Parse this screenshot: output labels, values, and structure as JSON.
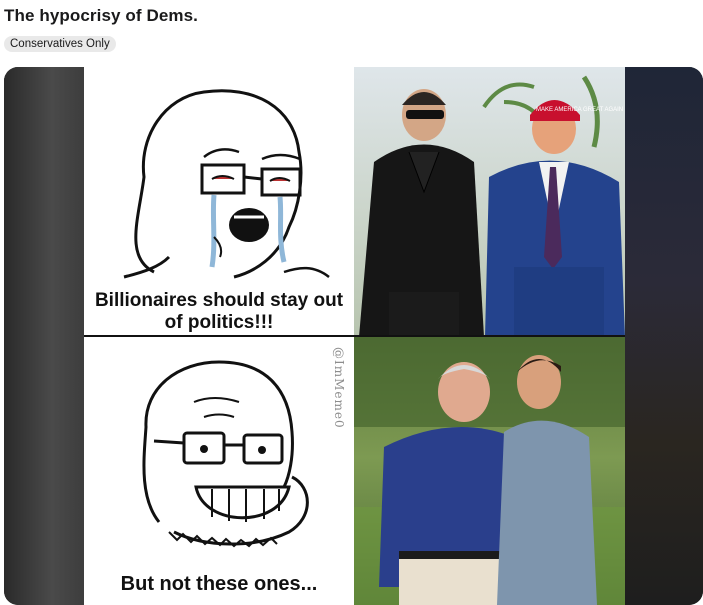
{
  "post": {
    "title": "The hypocrisy of Dems.",
    "flair": "Conservatives Only"
  },
  "meme": {
    "top_caption": "Billionaires should stay out of politics!!!",
    "bottom_caption": "But not these ones...",
    "watermark": "@ImMeme0",
    "hat_text": "MAKE AMERICA GREAT AGAIN"
  },
  "colors": {
    "flair_bg": "#e9e9e9",
    "media_bg": "#1c1c1c",
    "hat_red": "#c8102e",
    "suit_blue": "#24438d"
  }
}
